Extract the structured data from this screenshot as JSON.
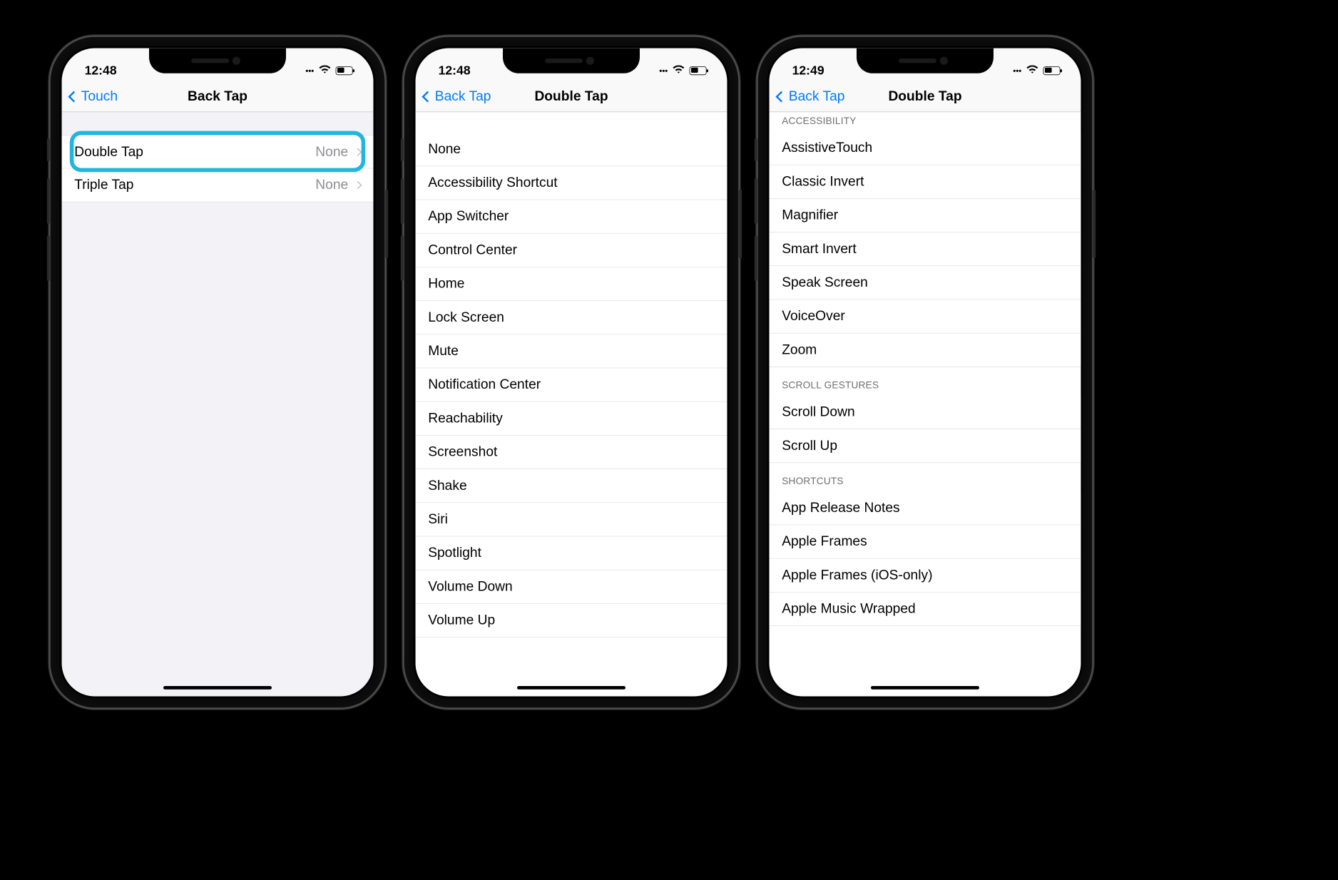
{
  "phone1": {
    "time": "12:48",
    "back": "Touch",
    "title": "Back Tap",
    "rows": [
      {
        "label": "Double Tap",
        "value": "None",
        "highlighted": true
      },
      {
        "label": "Triple Tap",
        "value": "None",
        "highlighted": false
      }
    ]
  },
  "phone2": {
    "time": "12:48",
    "back": "Back Tap",
    "title": "Double Tap",
    "options": [
      "None",
      "Accessibility Shortcut",
      "App Switcher",
      "Control Center",
      "Home",
      "Lock Screen",
      "Mute",
      "Notification Center",
      "Reachability",
      "Screenshot",
      "Shake",
      "Siri",
      "Spotlight",
      "Volume Down",
      "Volume Up"
    ]
  },
  "phone3": {
    "time": "12:49",
    "back": "Back Tap",
    "title": "Double Tap",
    "sections": [
      {
        "header": "ACCESSIBILITY",
        "items": [
          "AssistiveTouch",
          "Classic Invert",
          "Magnifier",
          "Smart Invert",
          "Speak Screen",
          "VoiceOver",
          "Zoom"
        ]
      },
      {
        "header": "SCROLL GESTURES",
        "items": [
          "Scroll Down",
          "Scroll Up"
        ]
      },
      {
        "header": "SHORTCUTS",
        "items": [
          "App Release Notes",
          "Apple Frames",
          "Apple Frames (iOS-only)",
          "Apple Music Wrapped"
        ]
      }
    ]
  }
}
